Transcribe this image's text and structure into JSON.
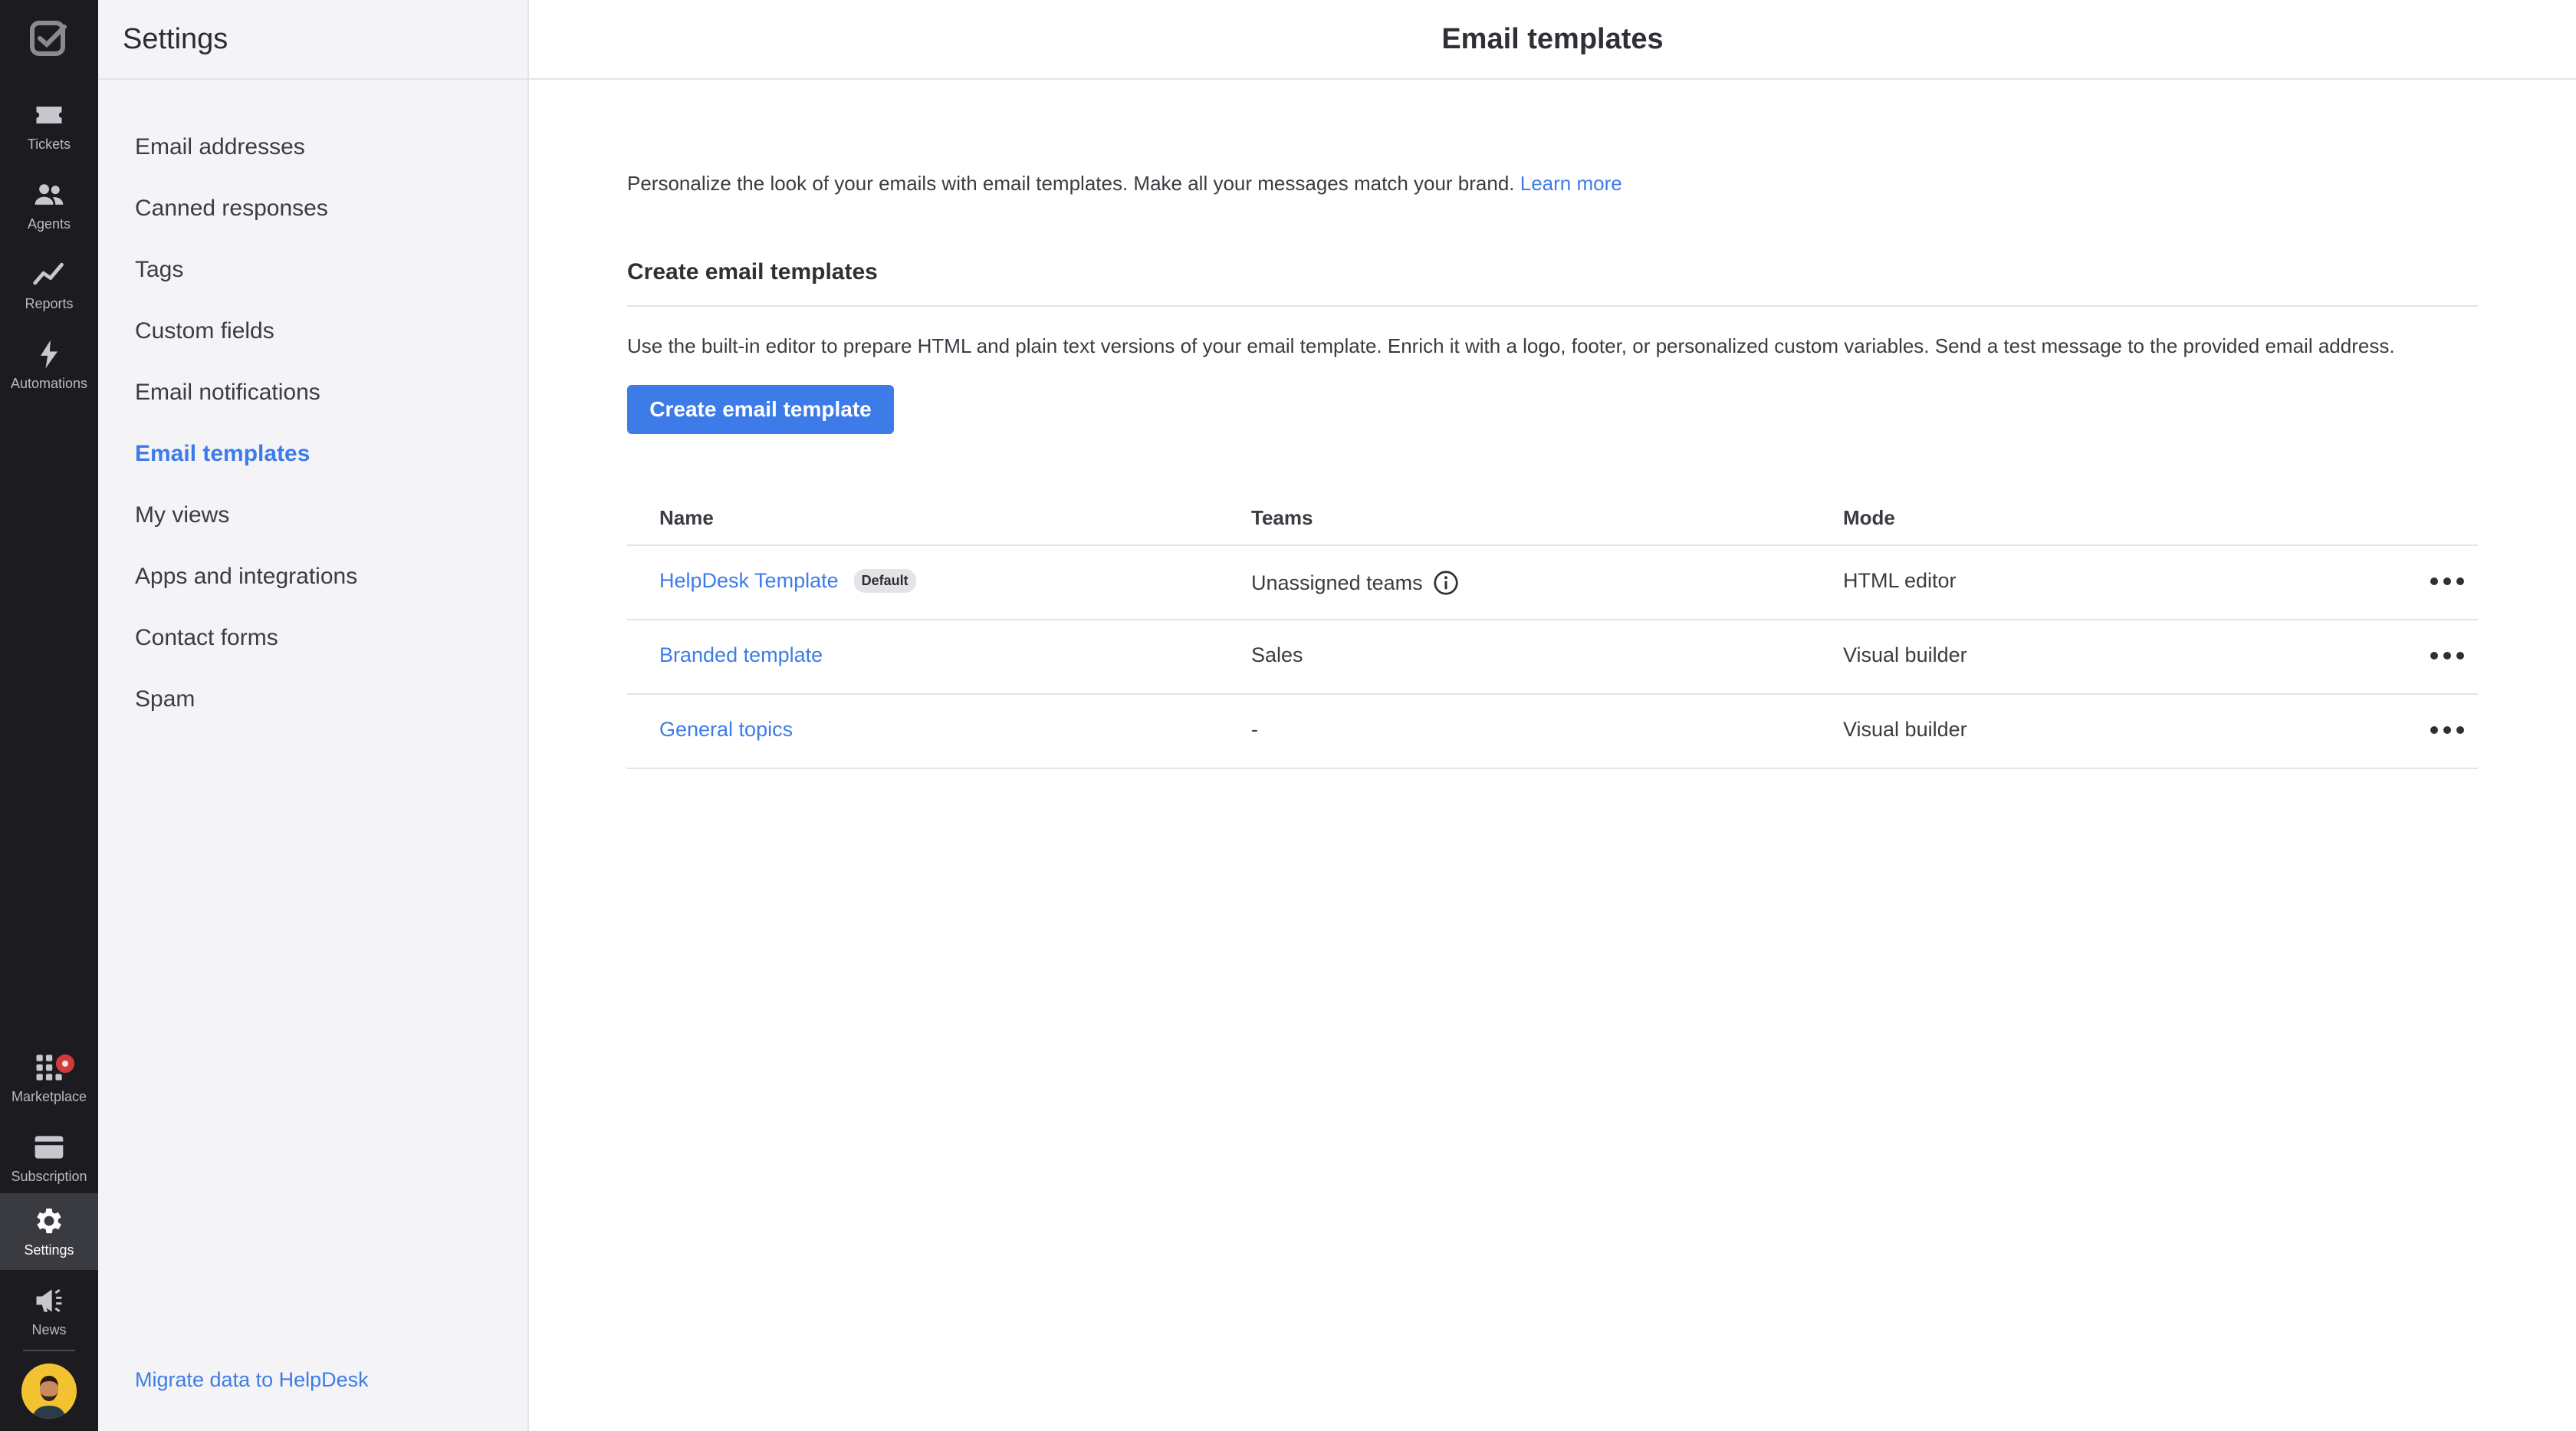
{
  "rail": {
    "items": [
      {
        "label": "Tickets",
        "icon": "tickets-icon"
      },
      {
        "label": "Agents",
        "icon": "agents-icon"
      },
      {
        "label": "Reports",
        "icon": "reports-icon"
      },
      {
        "label": "Automations",
        "icon": "automations-icon"
      },
      {
        "label": "Marketplace",
        "icon": "marketplace-icon"
      },
      {
        "label": "Subscription",
        "icon": "subscription-icon"
      },
      {
        "label": "Settings",
        "icon": "gear-icon",
        "active": true
      },
      {
        "label": "News",
        "icon": "megaphone-icon"
      }
    ]
  },
  "sidebar": {
    "title": "Settings",
    "items": [
      {
        "label": "Email addresses"
      },
      {
        "label": "Canned responses"
      },
      {
        "label": "Tags"
      },
      {
        "label": "Custom fields"
      },
      {
        "label": "Email notifications"
      },
      {
        "label": "Email templates",
        "active": true
      },
      {
        "label": "My views"
      },
      {
        "label": "Apps and integrations"
      },
      {
        "label": "Contact forms"
      },
      {
        "label": "Spam"
      }
    ],
    "migrate_link": "Migrate data to HelpDesk"
  },
  "main": {
    "title": "Email templates",
    "intro_text": "Personalize the look of your emails with email templates. Make all your messages match your brand.",
    "learn_more": "Learn more",
    "section_title": "Create email templates",
    "section_desc": "Use the built-in editor to prepare HTML and plain text versions of your email template. Enrich it with a logo, footer, or personalized custom variables. Send a test message to the provided email address.",
    "create_button": "Create email template",
    "table": {
      "headers": {
        "name": "Name",
        "teams": "Teams",
        "mode": "Mode"
      },
      "rows": [
        {
          "name": "HelpDesk Template",
          "badge": "Default",
          "teams": "Unassigned teams",
          "mode": "HTML editor"
        },
        {
          "name": "Branded template",
          "teams": "Sales",
          "mode": "Visual builder"
        },
        {
          "name": "General topics",
          "teams": "-",
          "mode": "Visual builder"
        }
      ]
    }
  },
  "colors": {
    "accent": "#3d7ce8",
    "rail_bg": "#1b1b20",
    "sidebar_bg": "#f4f4f7",
    "notification": "#d23b3b"
  }
}
